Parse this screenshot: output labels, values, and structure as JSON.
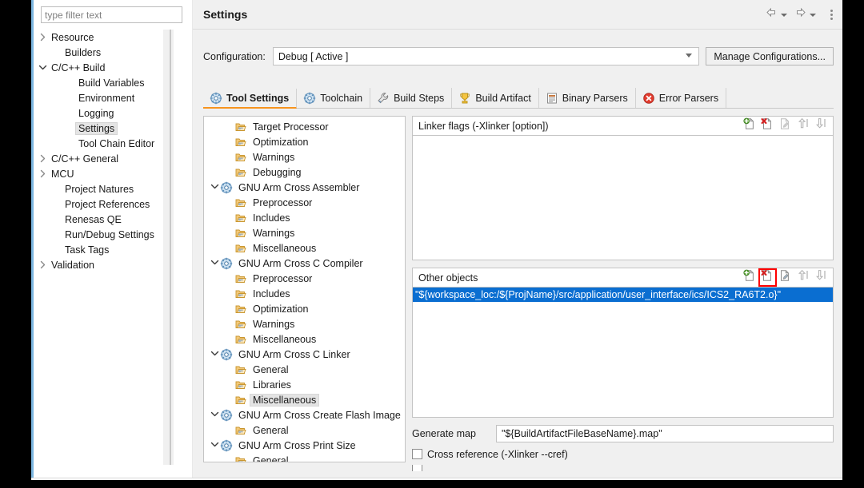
{
  "window": {
    "title": "Settings"
  },
  "sidebar": {
    "filter_placeholder": "type filter text",
    "filter_value": "",
    "items": [
      {
        "label": "Resource",
        "indent": 0,
        "twisty": "collapsed",
        "selected": false
      },
      {
        "label": "Builders",
        "indent": 1,
        "twisty": "none",
        "selected": false
      },
      {
        "label": "C/C++ Build",
        "indent": 0,
        "twisty": "expanded",
        "selected": false
      },
      {
        "label": "Build Variables",
        "indent": 2,
        "twisty": "none",
        "selected": false
      },
      {
        "label": "Environment",
        "indent": 2,
        "twisty": "none",
        "selected": false
      },
      {
        "label": "Logging",
        "indent": 2,
        "twisty": "none",
        "selected": false
      },
      {
        "label": "Settings",
        "indent": 2,
        "twisty": "none",
        "selected": true
      },
      {
        "label": "Tool Chain Editor",
        "indent": 2,
        "twisty": "none",
        "selected": false
      },
      {
        "label": "C/C++ General",
        "indent": 0,
        "twisty": "collapsed",
        "selected": false
      },
      {
        "label": "MCU",
        "indent": 0,
        "twisty": "collapsed",
        "selected": false
      },
      {
        "label": "Project Natures",
        "indent": 1,
        "twisty": "none",
        "selected": false
      },
      {
        "label": "Project References",
        "indent": 1,
        "twisty": "none",
        "selected": false
      },
      {
        "label": "Renesas QE",
        "indent": 1,
        "twisty": "none",
        "selected": false
      },
      {
        "label": "Run/Debug Settings",
        "indent": 1,
        "twisty": "none",
        "selected": false
      },
      {
        "label": "Task Tags",
        "indent": 1,
        "twisty": "none",
        "selected": false
      },
      {
        "label": "Validation",
        "indent": 0,
        "twisty": "collapsed",
        "selected": false
      }
    ]
  },
  "header": {
    "title": "Settings",
    "back_icon": "back-arrow-icon",
    "forward_icon": "forward-arrow-icon",
    "menu_icon": "view-menu-icon"
  },
  "configuration": {
    "label": "Configuration:",
    "value": "Debug  [ Active ]",
    "manage_button": "Manage Configurations..."
  },
  "tabs": [
    {
      "label": "Tool Settings",
      "icon": "gear-icon",
      "active": true
    },
    {
      "label": "Toolchain",
      "icon": "gear-icon",
      "active": false
    },
    {
      "label": "Build Steps",
      "icon": "wrench-icon",
      "active": false
    },
    {
      "label": "Build Artifact",
      "icon": "trophy-icon",
      "active": false
    },
    {
      "label": "Binary Parsers",
      "icon": "binary-parser-icon",
      "active": false
    },
    {
      "label": "Error Parsers",
      "icon": "error-icon",
      "active": false
    }
  ],
  "tool_tree": [
    {
      "label": "Target Processor",
      "indent": 1,
      "twisty": "none",
      "icon": "option-folder-icon",
      "selected": false
    },
    {
      "label": "Optimization",
      "indent": 1,
      "twisty": "none",
      "icon": "option-folder-icon",
      "selected": false
    },
    {
      "label": "Warnings",
      "indent": 1,
      "twisty": "none",
      "icon": "option-folder-icon",
      "selected": false
    },
    {
      "label": "Debugging",
      "indent": 1,
      "twisty": "none",
      "icon": "option-folder-icon",
      "selected": false
    },
    {
      "label": "GNU Arm Cross Assembler",
      "indent": 0,
      "twisty": "expanded",
      "icon": "tool-gear-icon",
      "selected": false
    },
    {
      "label": "Preprocessor",
      "indent": 1,
      "twisty": "none",
      "icon": "option-folder-icon",
      "selected": false
    },
    {
      "label": "Includes",
      "indent": 1,
      "twisty": "none",
      "icon": "option-folder-icon",
      "selected": false
    },
    {
      "label": "Warnings",
      "indent": 1,
      "twisty": "none",
      "icon": "option-folder-icon",
      "selected": false
    },
    {
      "label": "Miscellaneous",
      "indent": 1,
      "twisty": "none",
      "icon": "option-folder-icon",
      "selected": false
    },
    {
      "label": "GNU Arm Cross C Compiler",
      "indent": 0,
      "twisty": "expanded",
      "icon": "tool-gear-icon",
      "selected": false
    },
    {
      "label": "Preprocessor",
      "indent": 1,
      "twisty": "none",
      "icon": "option-folder-icon",
      "selected": false
    },
    {
      "label": "Includes",
      "indent": 1,
      "twisty": "none",
      "icon": "option-folder-icon",
      "selected": false
    },
    {
      "label": "Optimization",
      "indent": 1,
      "twisty": "none",
      "icon": "option-folder-icon",
      "selected": false
    },
    {
      "label": "Warnings",
      "indent": 1,
      "twisty": "none",
      "icon": "option-folder-icon",
      "selected": false
    },
    {
      "label": "Miscellaneous",
      "indent": 1,
      "twisty": "none",
      "icon": "option-folder-icon",
      "selected": false
    },
    {
      "label": "GNU Arm Cross C Linker",
      "indent": 0,
      "twisty": "expanded",
      "icon": "tool-gear-icon",
      "selected": false
    },
    {
      "label": "General",
      "indent": 1,
      "twisty": "none",
      "icon": "option-folder-icon",
      "selected": false
    },
    {
      "label": "Libraries",
      "indent": 1,
      "twisty": "none",
      "icon": "option-folder-icon",
      "selected": false
    },
    {
      "label": "Miscellaneous",
      "indent": 1,
      "twisty": "none",
      "icon": "option-folder-icon",
      "selected": true
    },
    {
      "label": "GNU Arm Cross Create Flash Image",
      "indent": 0,
      "twisty": "expanded",
      "icon": "tool-gear-icon",
      "selected": false
    },
    {
      "label": "General",
      "indent": 1,
      "twisty": "none",
      "icon": "option-folder-icon",
      "selected": false
    },
    {
      "label": "GNU Arm Cross Print Size",
      "indent": 0,
      "twisty": "expanded",
      "icon": "tool-gear-icon",
      "selected": false
    },
    {
      "label": "General",
      "indent": 1,
      "twisty": "none",
      "icon": "option-folder-icon",
      "selected": false
    }
  ],
  "linker_flags": {
    "title": "Linker flags (-Xlinker [option])",
    "items": [],
    "tools": [
      {
        "icon": "add-icon",
        "name": "add-linker-flag-button",
        "enabled": true,
        "highlighted": false
      },
      {
        "icon": "delete-icon",
        "name": "delete-linker-flag-button",
        "enabled": true,
        "highlighted": false
      },
      {
        "icon": "edit-icon",
        "name": "edit-linker-flag-button",
        "enabled": false,
        "highlighted": false
      },
      {
        "icon": "move-up-icon",
        "name": "move-up-button",
        "enabled": false,
        "highlighted": false
      },
      {
        "icon": "move-down-icon",
        "name": "move-down-button",
        "enabled": false,
        "highlighted": false
      }
    ]
  },
  "other_objects": {
    "title": "Other objects",
    "selected_item": "\"${workspace_loc:/${ProjName}/src/application/user_interface/ics/ICS2_RA6T2.o}\"",
    "tools": [
      {
        "icon": "add-icon",
        "name": "add-other-object-button",
        "enabled": true,
        "highlighted": false
      },
      {
        "icon": "delete-icon",
        "name": "delete-other-object-button",
        "enabled": true,
        "highlighted": true
      },
      {
        "icon": "edit-icon",
        "name": "edit-other-object-button",
        "enabled": true,
        "highlighted": false
      },
      {
        "icon": "move-up-icon",
        "name": "move-up-button",
        "enabled": false,
        "highlighted": false
      },
      {
        "icon": "move-down-icon",
        "name": "move-down-button",
        "enabled": false,
        "highlighted": false
      }
    ]
  },
  "generate_map": {
    "label": "Generate map",
    "value": "\"${BuildArtifactFileBaseName}.map\""
  },
  "cross_reference": {
    "label": "Cross reference (-Xlinker --cref)",
    "checked": false
  },
  "colors": {
    "selection_blue": "#0a6ed1",
    "highlight_red": "#ff0000",
    "active_tab_underline": "#f7941e",
    "accent_line": "#7cb6e0"
  }
}
